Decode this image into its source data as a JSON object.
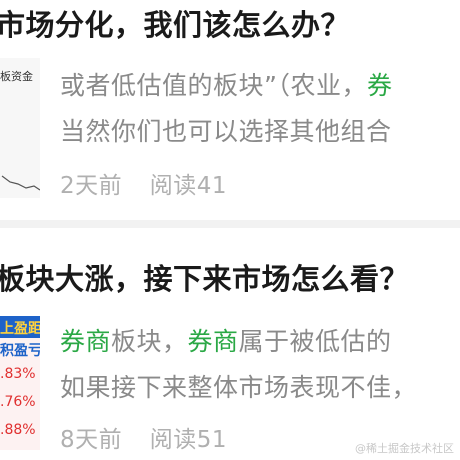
{
  "articles": [
    {
      "title": "市场分化，我们该怎么办？",
      "snippet_line1_before": "或者低估值的板块”（农业，",
      "snippet_line1_highlight": "券",
      "snippet_line2": "当然你们也可以选择其他组合",
      "age": "2天前",
      "reads": "阅读41",
      "thumb_caption": "板资金"
    },
    {
      "title": "板块大涨，接下来市场怎么看？",
      "snippet_line1_highlight_a": "券商",
      "snippet_line1_plain_a": "板块，",
      "snippet_line1_highlight_b": "券商",
      "snippet_line1_plain_b": "属于被低估的",
      "snippet_line2": "如果接下来整体市场表现不佳，",
      "age": "8天前",
      "reads": "阅读51",
      "thumb_rows": [
        "上盈距",
        "积盈亏",
        ".83%",
        ".76%",
        ".88%"
      ]
    }
  ],
  "watermark": "@稀土掘金技术社区"
}
